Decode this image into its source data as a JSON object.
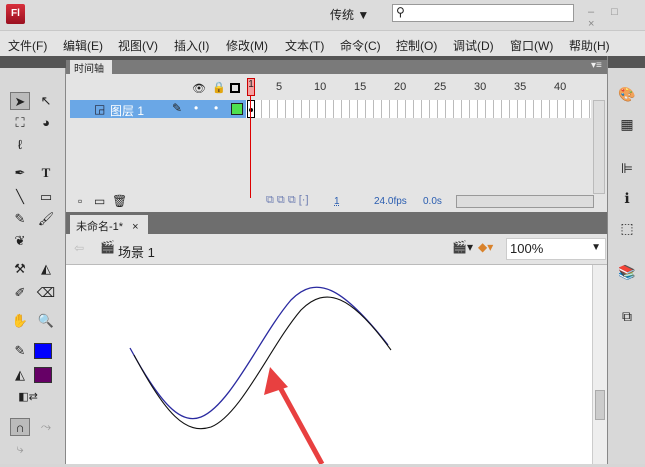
{
  "app": {
    "logo": "Fl",
    "workspace": "传统 ▼",
    "search_icon": "search-icon",
    "window_controls": "– □ ×"
  },
  "menu": [
    "文件(F)",
    "编辑(E)",
    "视图(V)",
    "插入(I)",
    "修改(M)",
    "文本(T)",
    "命令(C)",
    "控制(O)",
    "调试(D)",
    "窗口(W)",
    "帮助(H)"
  ],
  "timeline": {
    "tab": "时间轴",
    "layer_name": "图层 1",
    "frame_numbers": [
      "1",
      "5",
      "10",
      "15",
      "20",
      "25",
      "30",
      "35",
      "40"
    ],
    "current_frame": "1",
    "fps": "24.0fps",
    "time": "0.0s"
  },
  "document": {
    "tab": "未命名-1*",
    "close": "×",
    "scene": "场景 1",
    "zoom": "100%"
  },
  "colors": {
    "stroke": "#0000ff",
    "fill": "#660066",
    "curve_blue": "#2a2aa0",
    "arrow": "#e84040"
  }
}
